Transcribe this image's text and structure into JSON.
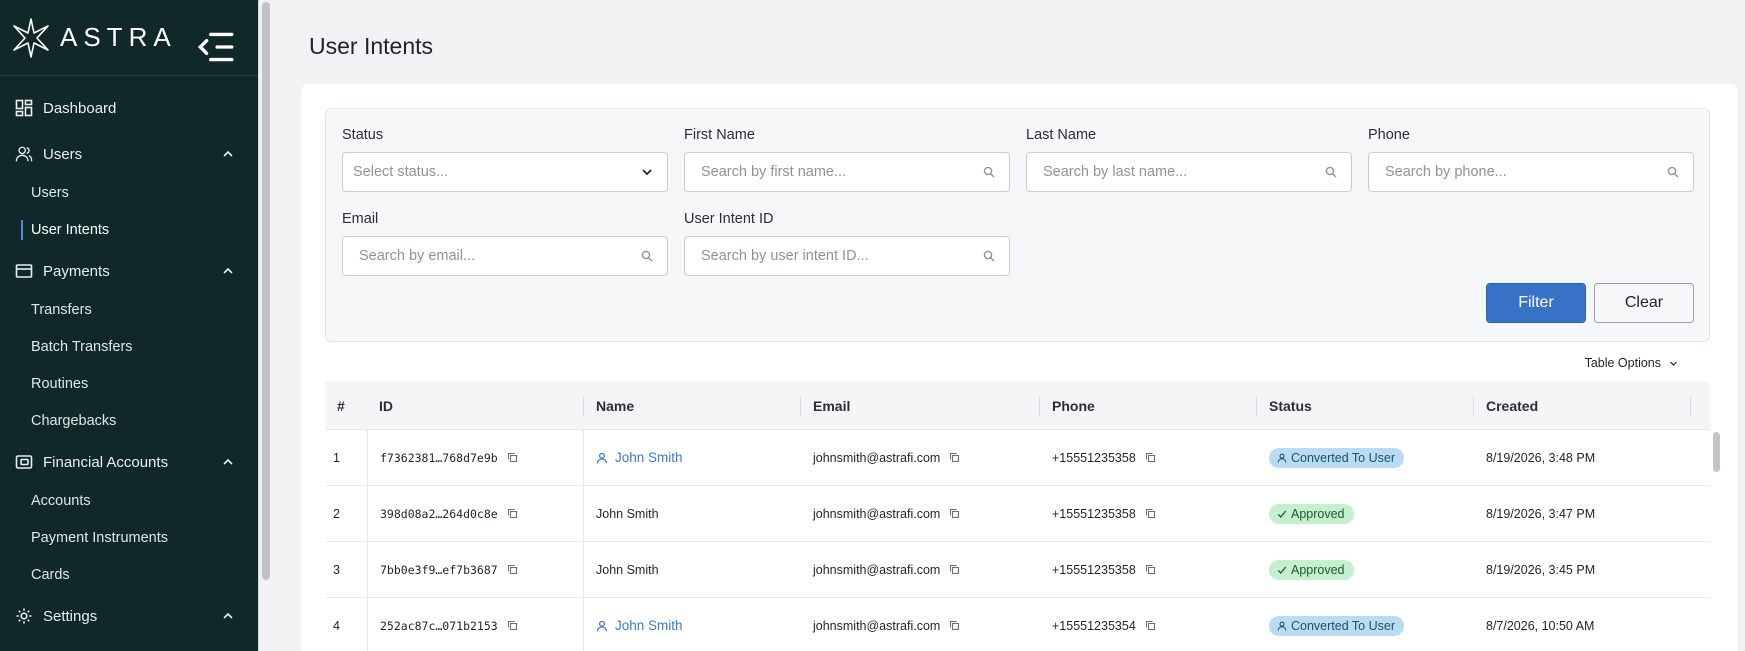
{
  "brand": {
    "name": "ASTRA"
  },
  "sidebar": {
    "groups": [
      {
        "label": "Dashboard",
        "icon": "dashboard-icon"
      },
      {
        "label": "Users",
        "icon": "users-icon",
        "items": [
          "Users",
          "User Intents"
        ]
      },
      {
        "label": "Payments",
        "icon": "payments-icon",
        "items": [
          "Transfers",
          "Batch Transfers",
          "Routines",
          "Chargebacks"
        ]
      },
      {
        "label": "Financial Accounts",
        "icon": "financial-accounts-icon",
        "items": [
          "Accounts",
          "Payment Instruments",
          "Cards"
        ]
      },
      {
        "label": "Settings",
        "icon": "gear-icon"
      }
    ],
    "active_item": "User Intents"
  },
  "page": {
    "title": "User Intents"
  },
  "filters": {
    "status": {
      "label": "Status",
      "placeholder": "Select status..."
    },
    "first_name": {
      "label": "First Name",
      "placeholder": "Search by first name..."
    },
    "last_name": {
      "label": "Last Name",
      "placeholder": "Search by last name..."
    },
    "phone": {
      "label": "Phone",
      "placeholder": "Search by phone..."
    },
    "email": {
      "label": "Email",
      "placeholder": "Search by email..."
    },
    "user_intent_id": {
      "label": "User Intent ID",
      "placeholder": "Search by user intent ID..."
    },
    "filter_label": "Filter",
    "clear_label": "Clear"
  },
  "table": {
    "options_label": "Table Options",
    "columns": [
      "#",
      "ID",
      "Name",
      "Email",
      "Phone",
      "Status",
      "Created"
    ],
    "rows": [
      {
        "num": "1",
        "id": "f7362381…768d7e9b",
        "name": "John Smith",
        "name_linked": true,
        "email": "johnsmith@astrafi.com",
        "phone": "+15551235358",
        "status": "Converted To User",
        "status_kind": "converted",
        "created": "8/19/2026, 3:48 PM"
      },
      {
        "num": "2",
        "id": "398d08a2…264d0c8e",
        "name": "John Smith",
        "name_linked": false,
        "email": "johnsmith@astrafi.com",
        "phone": "+15551235358",
        "status": "Approved",
        "status_kind": "approved",
        "created": "8/19/2026, 3:47 PM"
      },
      {
        "num": "3",
        "id": "7bb0e3f9…ef7b3687",
        "name": "John Smith",
        "name_linked": false,
        "email": "johnsmith@astrafi.com",
        "phone": "+15551235358",
        "status": "Approved",
        "status_kind": "approved",
        "created": "8/19/2026, 3:45 PM"
      },
      {
        "num": "4",
        "id": "252ac87c…071b2153",
        "name": "John Smith",
        "name_linked": true,
        "email": "johnsmith@astrafi.com",
        "phone": "+15551235354",
        "status": "Converted To User",
        "status_kind": "converted",
        "created": "8/7/2026, 10:50 AM"
      }
    ]
  },
  "colors": {
    "sidebar_bg": "#10282a",
    "accent": "#3872c7",
    "link": "#3b78c9",
    "converted_badge": "#b9dcf2",
    "approved_badge": "#c6efcf"
  }
}
